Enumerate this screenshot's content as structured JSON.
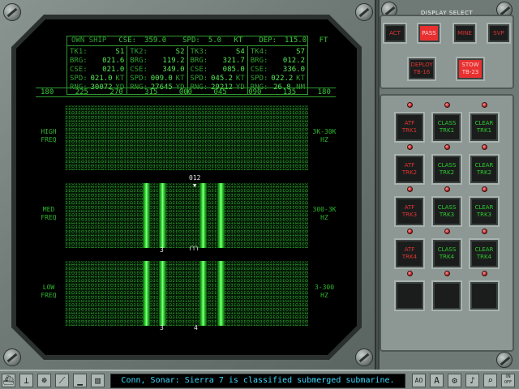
{
  "ownship": {
    "label": "OWN SHIP",
    "cse_label": "CSE:",
    "cse": "359.0",
    "spd_label": "SPD:",
    "spd": "5.0",
    "spd_unit": "KT",
    "dep_label": "DEP:",
    "dep": "115.0",
    "dep_unit": "FT"
  },
  "tracks": [
    {
      "id": "TK1:",
      "name": "S1",
      "brg": "021.6",
      "cse": "021.0",
      "spd": "021.0",
      "spd_unit": "KT",
      "rng": "30072",
      "rng_unit": "YD"
    },
    {
      "id": "TK2:",
      "name": "S2",
      "brg": "119.2",
      "cse": "349.0",
      "spd": "009.0",
      "spd_unit": "KT",
      "rng": "27645",
      "rng_unit": "YD"
    },
    {
      "id": "TK3:",
      "name": "S4",
      "brg": "321.7",
      "cse": "085.0",
      "spd": "045.2",
      "spd_unit": "KT",
      "rng": "29212",
      "rng_unit": "YD"
    },
    {
      "id": "TK4:",
      "name": "S7",
      "brg": "012.2",
      "cse": "336.0",
      "spd": "022.2",
      "spd_unit": "KT",
      "rng": "26.8",
      "rng_unit": "NM"
    }
  ],
  "track_labels": {
    "brg": "BRG:",
    "cse": "CSE:",
    "spd": "SPD:",
    "rng": "RNG:"
  },
  "bearing_scale": [
    "180",
    "225",
    "270",
    "315",
    "000",
    "045",
    "090",
    "135",
    "180"
  ],
  "bands": [
    {
      "name_l1": "HIGH",
      "name_l2": "FREQ",
      "range_l1": "3K-30K",
      "range_l2": "HZ"
    },
    {
      "name_l1": "MED",
      "name_l2": "FREQ",
      "range_l1": "300-3K",
      "range_l2": "HZ"
    },
    {
      "name_l1": "LOW",
      "name_l2": "FREQ",
      "range_l1": "3-300",
      "range_l2": "HZ"
    }
  ],
  "markers": {
    "top": "012",
    "med_bottom": "3",
    "low_left": "3",
    "low_right": "4"
  },
  "display_select": {
    "title": "DISPLAY SELECT",
    "modes": [
      "ACT",
      "PASS",
      "MINE",
      "SVP"
    ],
    "active_mode": "PASS",
    "deploy": {
      "l1": "DEPLOY",
      "l2": "TB-16"
    },
    "stow": {
      "l1": "STOW",
      "l2": "TB-23"
    }
  },
  "track_buttons": [
    {
      "atf": [
        "ATF",
        "TRK1"
      ],
      "class": [
        "CLASS",
        "TRK1"
      ],
      "clear": [
        "CLEAR",
        "TRK1"
      ]
    },
    {
      "atf": [
        "ATF",
        "TRK2"
      ],
      "class": [
        "CLASS",
        "TRK2"
      ],
      "clear": [
        "CLEAR",
        "TRK2"
      ]
    },
    {
      "atf": [
        "ATF",
        "TRK3"
      ],
      "class": [
        "CLASS",
        "TRK3"
      ],
      "clear": [
        "CLEAR",
        "TRK3"
      ]
    },
    {
      "atf": [
        "ATF",
        "TRK4"
      ],
      "class": [
        "CLASS",
        "TRK4"
      ],
      "clear": [
        "CLEAR",
        "TRK4"
      ]
    }
  ],
  "status_message": "Conn, Sonar: Sierra 7 is classified submerged submarine.",
  "toolbar_left": [
    "ship-icon",
    "periscope-icon",
    "helm-icon",
    "compass-icon",
    "chart-icon",
    "film-icon"
  ],
  "toolbar_right": [
    "AO",
    "A",
    "gear-icon",
    "speaker-icon",
    "magnify-icon",
    "options-icon"
  ],
  "toolbar_right_labels": {
    "ao": "AO",
    "a": "A",
    "opt1": "ON",
    "opt2": "OFF"
  },
  "colors": {
    "accent_green": "#3bd43b",
    "lamp_red": "#e03434",
    "message_cyan": "#3ad8ff"
  }
}
